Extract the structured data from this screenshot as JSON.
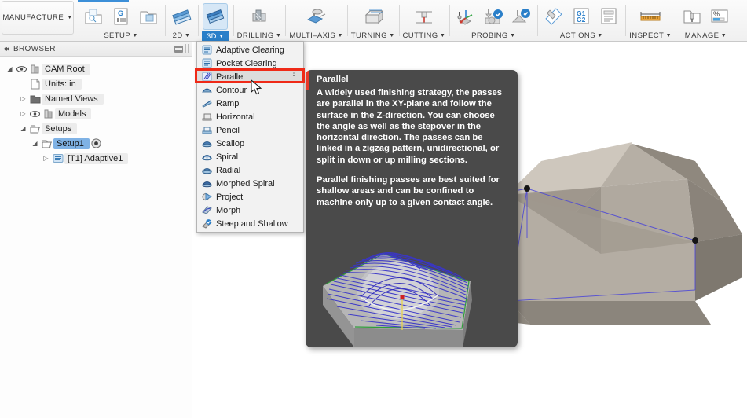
{
  "app": {
    "workspace_button": "MANUFACTURE",
    "caret": "▼"
  },
  "ribbon": {
    "groups": [
      {
        "label": "SETUP",
        "name": "setup",
        "icons": [
          "new-setup-icon",
          "new-manual-ncp-icon",
          "new-folder-icon"
        ]
      },
      {
        "label": "2D",
        "name": "2d",
        "icons": [
          "2d-milling-icon"
        ]
      },
      {
        "label": "3D",
        "name": "3d",
        "icons": [
          "3d-milling-icon"
        ],
        "active": true
      },
      {
        "label": "DRILLING",
        "name": "drilling",
        "icons": [
          "drilling-icon"
        ]
      },
      {
        "label": "MULTI–AXIS",
        "name": "multi-axis",
        "icons": [
          "multi-axis-icon"
        ]
      },
      {
        "label": "TURNING",
        "name": "turning",
        "icons": [
          "turning-icon"
        ]
      },
      {
        "label": "CUTTING",
        "name": "cutting",
        "icons": [
          "cutting-icon"
        ]
      },
      {
        "label": "PROBING",
        "name": "probing",
        "icons": [
          "probe-wcs-icon",
          "probe-geometry-icon",
          "probe-surface-icon"
        ]
      },
      {
        "label": "ACTIONS",
        "name": "actions",
        "icons": [
          "post-process-icon",
          "g1g2-icon",
          "setup-sheet-icon"
        ]
      },
      {
        "label": "INSPECT",
        "name": "inspect",
        "icons": [
          "measure-icon"
        ]
      },
      {
        "label": "MANAGE",
        "name": "manage",
        "icons": [
          "tool-library-icon",
          "machining-time-icon"
        ]
      }
    ]
  },
  "browser": {
    "title": "BROWSER",
    "collapse_icon": "collapse-panel-icon",
    "menu_icon": "panel-menu-icon",
    "tree": [
      {
        "label": "CAM Root",
        "indent": 0,
        "arrow": "◢",
        "eye": true,
        "icon": "cam-root-icon",
        "selected": false,
        "after": ""
      },
      {
        "label": "Units: in",
        "indent": 1,
        "arrow": "",
        "eye": false,
        "icon": "units-icon",
        "selected": false,
        "after": ""
      },
      {
        "label": "Named Views",
        "indent": 1,
        "arrow": "▷",
        "eye": false,
        "icon": "folder-icon",
        "selected": false,
        "after": ""
      },
      {
        "label": "Models",
        "indent": 1,
        "arrow": "▷",
        "eye": true,
        "icon": "models-icon",
        "selected": false,
        "after": ""
      },
      {
        "label": "Setups",
        "indent": 1,
        "arrow": "◢",
        "eye": false,
        "icon": "setups-folder-icon",
        "selected": false,
        "after": ""
      },
      {
        "label": "Setup1",
        "indent": 2,
        "arrow": "◢",
        "eye": false,
        "icon": "setup-folder-icon",
        "selected": true,
        "after": "activate-icon"
      },
      {
        "label": "[T1] Adaptive1",
        "indent": 3,
        "arrow": "▷",
        "eye": false,
        "icon": "operation-icon",
        "selected": false,
        "after": ""
      }
    ]
  },
  "menu": {
    "name": "3d-strategies-menu",
    "items": [
      {
        "label": "Adaptive Clearing",
        "icon": "adaptive-clearing-icon",
        "highlighted": false
      },
      {
        "label": "Pocket Clearing",
        "icon": "pocket-clearing-icon",
        "highlighted": false
      },
      {
        "label": "Parallel",
        "icon": "parallel-icon",
        "highlighted": true,
        "overflow": "⋮"
      },
      {
        "label": "Contour",
        "icon": "contour-icon",
        "highlighted": false
      },
      {
        "label": "Ramp",
        "icon": "ramp-icon",
        "highlighted": false
      },
      {
        "label": "Horizontal",
        "icon": "horizontal-icon",
        "highlighted": false
      },
      {
        "label": "Pencil",
        "icon": "pencil-icon",
        "highlighted": false
      },
      {
        "label": "Scallop",
        "icon": "scallop-icon",
        "highlighted": false
      },
      {
        "label": "Spiral",
        "icon": "spiral-icon",
        "highlighted": false
      },
      {
        "label": "Radial",
        "icon": "radial-icon",
        "highlighted": false
      },
      {
        "label": "Morphed Spiral",
        "icon": "morphed-spiral-icon",
        "highlighted": false
      },
      {
        "label": "Project",
        "icon": "project-icon",
        "highlighted": false
      },
      {
        "label": "Morph",
        "icon": "morph-icon",
        "highlighted": false
      },
      {
        "label": "Steep and Shallow",
        "icon": "steep-and-shallow-icon",
        "highlighted": false
      }
    ]
  },
  "tooltip": {
    "name": "parallel-tooltip",
    "title": "Parallel",
    "paragraph1": "A widely used finishing strategy, the passes are parallel in the XY-plane and follow the surface in the Z-direction. You can choose the angle as well as the stepover in the horizontal direction. The passes can be linked in a zigzag pattern, unidirectional, or split in down or up milling sections.",
    "paragraph2": "Parallel finishing passes are best suited for shallow areas and can be confined to machine only up to a given contact angle.",
    "preview_image": "parallel-toolpath-preview"
  },
  "viewport": {
    "name": "cam-3d-viewport",
    "model": "faceted-stock-model"
  },
  "colors": {
    "accent_blue": "#2a7fc9",
    "highlight_red": "#ef2a18",
    "tooltip_bg": "#4a4a4a",
    "selection_blue": "#7fb2e5",
    "toolpath_blue": "#3a36c8"
  }
}
